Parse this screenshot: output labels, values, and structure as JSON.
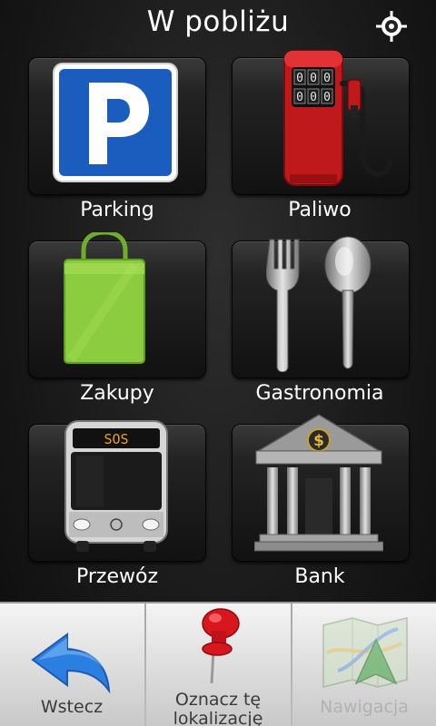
{
  "header": {
    "title": "W pobliżu",
    "gps_icon": "gps-crosshair-icon"
  },
  "categories": [
    {
      "label": "Parking",
      "icon": "parking-sign-icon"
    },
    {
      "label": "Paliwo",
      "icon": "fuel-pump-icon",
      "pump_digits": [
        "0",
        "0",
        "0",
        "0",
        "0",
        "0"
      ]
    },
    {
      "label": "Zakupy",
      "icon": "shopping-bag-icon"
    },
    {
      "label": "Gastronomia",
      "icon": "fork-spoon-icon"
    },
    {
      "label": "Przewóz",
      "icon": "bus-icon",
      "bus_display": "SOS"
    },
    {
      "label": "Bank",
      "icon": "bank-building-icon",
      "bank_symbol": "$"
    }
  ],
  "bottom_bar": {
    "back_label": "Wstecz",
    "mark_location_label": "Oznacz tę lokalizację",
    "navigation_label": "Nawigacja",
    "navigation_enabled": false
  },
  "colors": {
    "parking_blue": "#1a5dbf",
    "fuel_red": "#c0191c",
    "bag_green": "#8ccd3f",
    "back_arrow_blue": "#2a7fe0",
    "pin_red": "#d8161d"
  }
}
